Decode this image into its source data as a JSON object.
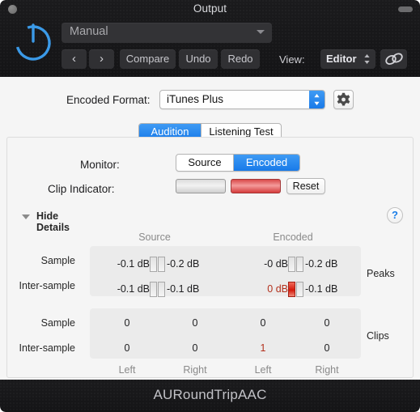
{
  "window": {
    "title": "Output",
    "close_icon": "close-circle-icon",
    "resize_icon": "resize-pill-icon"
  },
  "header": {
    "power_icon": "power-icon",
    "power_color": "#3b9ae8",
    "preset": {
      "value": "Manual",
      "chevron_icon": "chevron-down-icon"
    },
    "transport": {
      "prev_label": "‹",
      "next_label": "›",
      "compare_label": "Compare",
      "undo_label": "Undo",
      "redo_label": "Redo"
    },
    "view": {
      "label": "View:",
      "value": "Editor",
      "stepper_icon": "stepper-updown-icon",
      "link_icon": "link-chain-icon"
    }
  },
  "format_row": {
    "label": "Encoded Format:",
    "value": "iTunes Plus",
    "stepper_icon": "stepper-updown-icon",
    "gear_icon": "gear-icon",
    "accent_color": "#1a7ae8"
  },
  "tabs": [
    {
      "label": "Audition",
      "selected": true
    },
    {
      "label": "Listening Test",
      "selected": false
    }
  ],
  "monitor": {
    "label": "Monitor:",
    "options": [
      {
        "label": "Source",
        "selected": false
      },
      {
        "label": "Encoded",
        "selected": true
      }
    ]
  },
  "clip_indicator": {
    "label": "Clip Indicator:",
    "left_state": "off",
    "right_state": "on",
    "reset_label": "Reset"
  },
  "details": {
    "toggle_label": "Hide Details",
    "triangle_icon": "disclosure-triangle-down-icon",
    "help_icon": "help-question-icon",
    "help_label": "?"
  },
  "columns": {
    "groups": [
      "Source",
      "Encoded"
    ],
    "channels": [
      "Left",
      "Right",
      "Left",
      "Right"
    ]
  },
  "peaks": {
    "side_label": "Peaks",
    "rows": [
      {
        "label": "Sample",
        "cells": [
          {
            "value": "-0.1 dB",
            "clipped": false,
            "meter": "normal"
          },
          {
            "value": "-0.2 dB",
            "clipped": false,
            "meter": "normal"
          },
          {
            "value": "-0 dB",
            "clipped": false,
            "meter": "normal"
          },
          {
            "value": "-0.2 dB",
            "clipped": false,
            "meter": "normal"
          }
        ]
      },
      {
        "label": "Inter-sample",
        "cells": [
          {
            "value": "-0.1 dB",
            "clipped": false,
            "meter": "normal"
          },
          {
            "value": "-0.1 dB",
            "clipped": false,
            "meter": "normal"
          },
          {
            "value": "0 dB",
            "clipped": true,
            "meter": "hot"
          },
          {
            "value": "-0.1 dB",
            "clipped": false,
            "meter": "normal"
          }
        ]
      }
    ]
  },
  "clips": {
    "side_label": "Clips",
    "rows": [
      {
        "label": "Sample",
        "cells": [
          {
            "value": "0",
            "clipped": false
          },
          {
            "value": "0",
            "clipped": false
          },
          {
            "value": "0",
            "clipped": false
          },
          {
            "value": "0",
            "clipped": false
          }
        ]
      },
      {
        "label": "Inter-sample",
        "cells": [
          {
            "value": "0",
            "clipped": false
          },
          {
            "value": "0",
            "clipped": false
          },
          {
            "value": "1",
            "clipped": true
          },
          {
            "value": "0",
            "clipped": false
          }
        ]
      }
    ]
  },
  "footer": {
    "plugin_name": "AURoundTripAAC"
  }
}
